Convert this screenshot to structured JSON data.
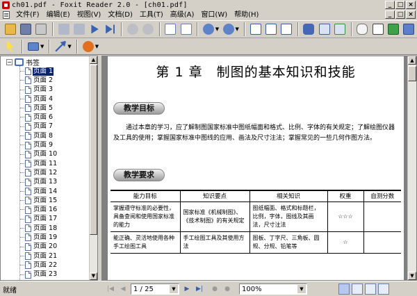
{
  "window": {
    "title": "ch01.pdf - Foxit Reader 2.0 - [ch01.pdf]",
    "buttons": [
      "_",
      "□",
      "×"
    ]
  },
  "menu": {
    "items": [
      "文件(F)",
      "编辑(E)",
      "视图(V)",
      "文档(D)",
      "工具(T)",
      "高级(A)",
      "窗口(W)",
      "帮助(H)"
    ],
    "doc_buttons": [
      "_",
      "□",
      "×"
    ]
  },
  "sidebar": {
    "root_label": "书签",
    "bookmarks": [
      "页面 1",
      "页面 2",
      "页面 3",
      "页面 4",
      "页面 5",
      "页面 6",
      "页面 7",
      "页面 8",
      "页面 9",
      "页面 10",
      "页面 11",
      "页面 12",
      "页面 13",
      "页面 14",
      "页面 15",
      "页面 16",
      "页面 17",
      "页面 18",
      "页面 19",
      "页面 20",
      "页面 21",
      "页面 22",
      "页面 23"
    ],
    "selected_index": 0
  },
  "document": {
    "chapter_title": "第 1 章　制图的基本知识和技能",
    "section1": "教学目标",
    "paragraph": "通过本章的学习，应了解制图国家标准中图纸幅面和格式、比例、字体的有关规定；了解绘图仪器及工具的使用；掌握国家标准中图线的应用、画法及尺寸注法；掌握常见的一些几何作图方法。",
    "section2": "教学要求",
    "table": {
      "headers": [
        "能力目标",
        "知识要点",
        "相关知识",
        "权重",
        "自测分数"
      ],
      "rows": [
        [
          "掌握遵守标准的必要性，具备查阅和使用国家标准的能力",
          "国家标准《机械制图》、《技术制图》的有关规定",
          "图纸幅面、格式和标题栏，比例，字体，图线及其画法，尺寸注法",
          "☆☆☆",
          ""
        ],
        [
          "能正确、灵活地使用各种手工绘图工具",
          "手工绘图工具及其使用方法",
          "图板、丁字尺、三角板、圆规、分规、铅笔等",
          "☆",
          ""
        ]
      ]
    }
  },
  "statusbar": {
    "status": "就绪",
    "page_field": "1 / 25",
    "zoom": "100%"
  }
}
